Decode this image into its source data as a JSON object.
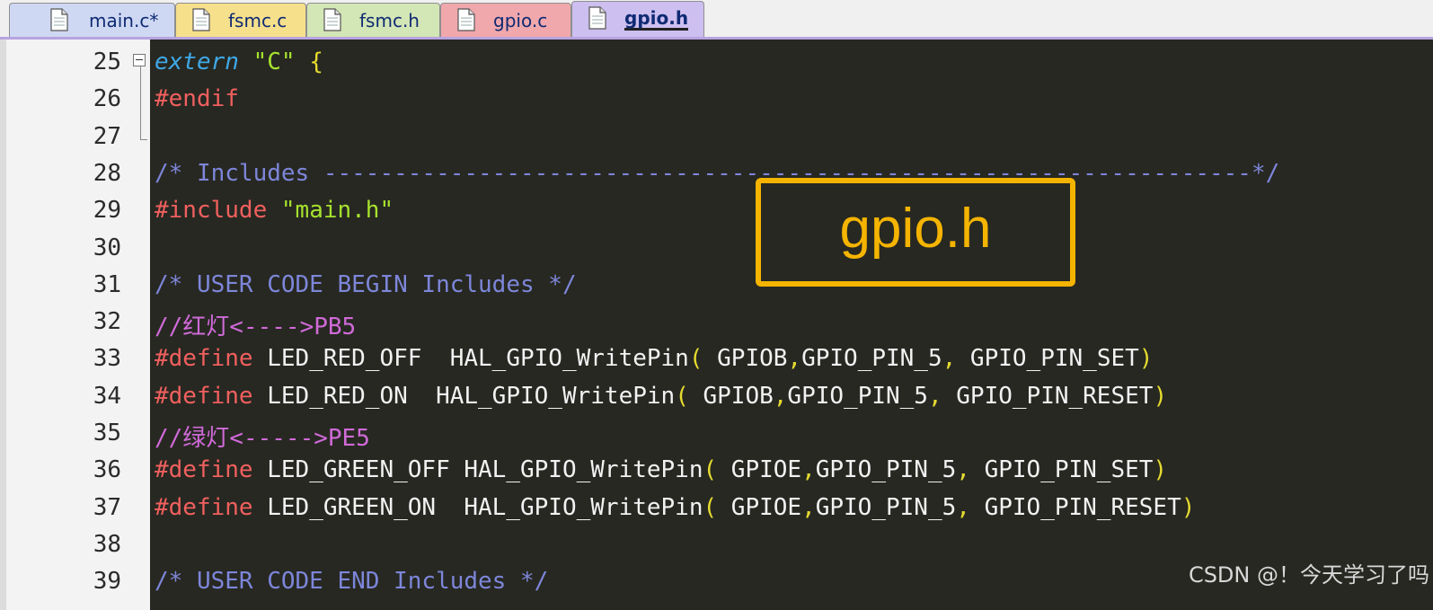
{
  "tabs": [
    {
      "label": "main.c*",
      "color": "#cfd8f3",
      "active": false
    },
    {
      "label": "fsmc.c",
      "color": "#f7e08c",
      "active": false
    },
    {
      "label": "fsmc.h",
      "color": "#d3e6b5",
      "active": false
    },
    {
      "label": "gpio.c",
      "color": "#f0a8ac",
      "active": false
    },
    {
      "label": "gpio.h",
      "color": "#cdbff0",
      "active": true
    }
  ],
  "lines": [
    {
      "no": "25",
      "tokens": [
        [
          "kw-extern",
          "extern"
        ],
        [
          "ident",
          " "
        ],
        [
          "str",
          "\"C\""
        ],
        [
          "ident",
          " "
        ],
        [
          "brace",
          "{"
        ]
      ]
    },
    {
      "no": "26",
      "tokens": [
        [
          "pre",
          "#endif"
        ]
      ]
    },
    {
      "no": "27",
      "tokens": []
    },
    {
      "no": "28",
      "tokens": [
        [
          "cmt",
          "/* Includes ------------------------------------------------------------------*/"
        ]
      ]
    },
    {
      "no": "29",
      "tokens": [
        [
          "pre",
          "#include"
        ],
        [
          "ident",
          " "
        ],
        [
          "str",
          "\"main.h\""
        ]
      ]
    },
    {
      "no": "30",
      "tokens": []
    },
    {
      "no": "31",
      "tokens": [
        [
          "cmt",
          "/* USER CODE BEGIN Includes */"
        ]
      ]
    },
    {
      "no": "32",
      "tokens": [
        [
          "cmt-cn",
          "//红灯<---->PB5"
        ]
      ]
    },
    {
      "no": "33",
      "tokens": [
        [
          "pre",
          "#define"
        ],
        [
          "ident",
          " LED_RED_OFF  HAL_GPIO_WritePin"
        ],
        [
          "paren",
          "("
        ],
        [
          "ident",
          " GPIOB"
        ],
        [
          "comma",
          ","
        ],
        [
          "ident",
          "GPIO_PIN_5"
        ],
        [
          "comma",
          ","
        ],
        [
          "ident",
          " GPIO_PIN_SET"
        ],
        [
          "paren",
          ")"
        ]
      ]
    },
    {
      "no": "34",
      "tokens": [
        [
          "pre",
          "#define"
        ],
        [
          "ident",
          " LED_RED_ON  HAL_GPIO_WritePin"
        ],
        [
          "paren",
          "("
        ],
        [
          "ident",
          " GPIOB"
        ],
        [
          "comma",
          ","
        ],
        [
          "ident",
          "GPIO_PIN_5"
        ],
        [
          "comma",
          ","
        ],
        [
          "ident",
          " GPIO_PIN_RESET"
        ],
        [
          "paren",
          ")"
        ]
      ]
    },
    {
      "no": "35",
      "tokens": [
        [
          "cmt-cn",
          "//绿灯<----->PE5"
        ]
      ]
    },
    {
      "no": "36",
      "tokens": [
        [
          "pre",
          "#define"
        ],
        [
          "ident",
          " LED_GREEN_OFF HAL_GPIO_WritePin"
        ],
        [
          "paren",
          "("
        ],
        [
          "ident",
          " GPIOE"
        ],
        [
          "comma",
          ","
        ],
        [
          "ident",
          "GPIO_PIN_5"
        ],
        [
          "comma",
          ","
        ],
        [
          "ident",
          " GPIO_PIN_SET"
        ],
        [
          "paren",
          ")"
        ]
      ]
    },
    {
      "no": "37",
      "tokens": [
        [
          "pre",
          "#define"
        ],
        [
          "ident",
          " LED_GREEN_ON  HAL_GPIO_WritePin"
        ],
        [
          "paren",
          "("
        ],
        [
          "ident",
          " GPIOE"
        ],
        [
          "comma",
          ","
        ],
        [
          "ident",
          "GPIO_PIN_5"
        ],
        [
          "comma",
          ","
        ],
        [
          "ident",
          " GPIO_PIN_RESET"
        ],
        [
          "paren",
          ")"
        ]
      ]
    },
    {
      "no": "38",
      "tokens": []
    },
    {
      "no": "39",
      "tokens": [
        [
          "cmt",
          "/* USER CODE END Includes */"
        ]
      ]
    }
  ],
  "annotation": {
    "text": "gpio.h",
    "color": "#f5b400"
  },
  "watermark": "CSDN @！今天学习了吗",
  "theme": {
    "editor_bg": "#272822",
    "gutter_bg": "#f3f3f3",
    "preprocessor": "#f0605e",
    "string": "#a6e22e",
    "comment": "#7d86d9",
    "comment_cn": "#d06ad8",
    "keyword": "#3fa8e6",
    "punct": "#e6db30"
  },
  "icons": {
    "tab_file": "file-document-icon",
    "fold": "fold-minus-icon"
  }
}
